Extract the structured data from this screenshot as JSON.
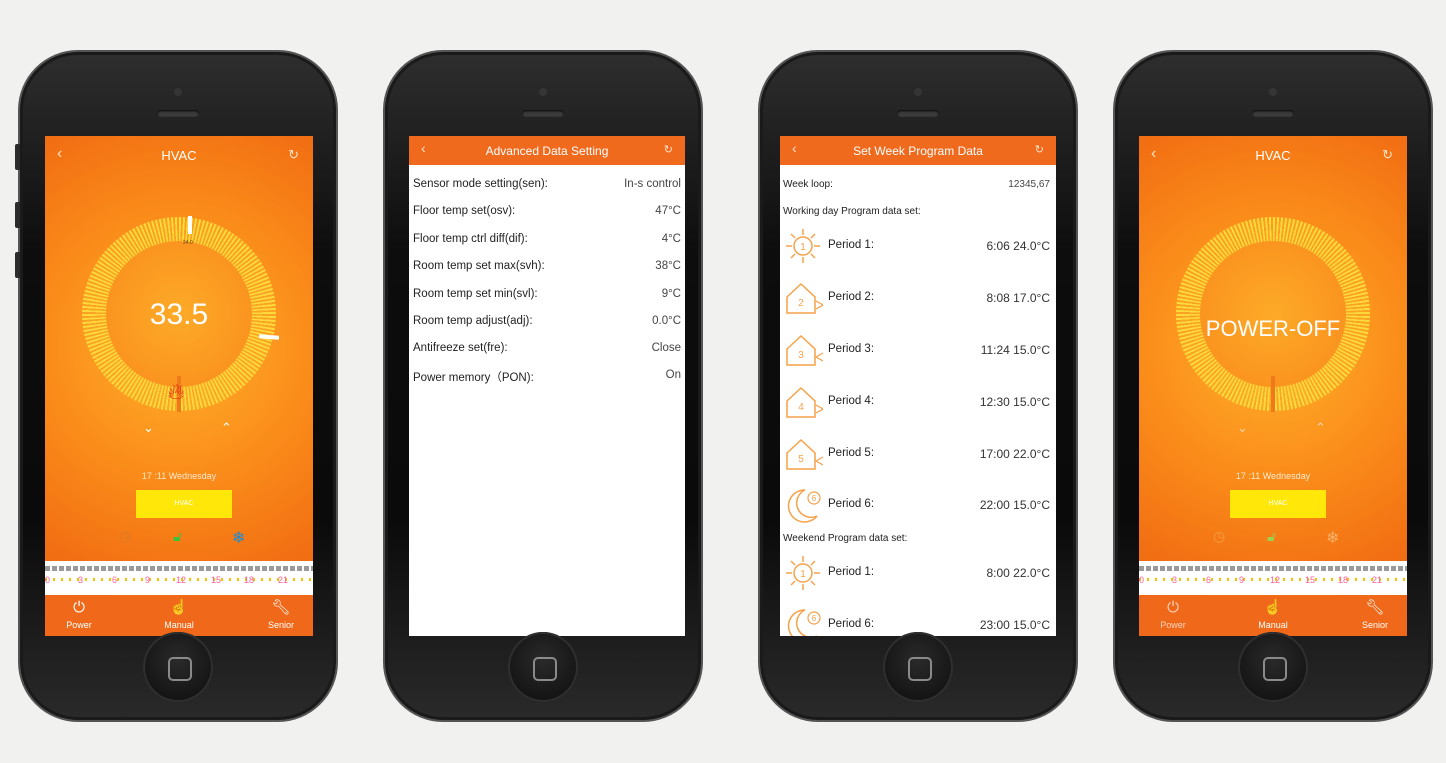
{
  "colors": {
    "accent": "#f06a1e",
    "mode_button": "#ffe70a",
    "flame": "#e31b0f",
    "page_bg": "#f1f1ef"
  },
  "phone1": {
    "title": "HVAC",
    "back_icon": "chevron-left-icon",
    "refresh_icon": "refresh-icon",
    "temperature": "33.5",
    "set_point": "24.0",
    "time": "17 :11 Wednesday",
    "mode_button": "HVAC",
    "timeline_ticks": [
      "0",
      "3",
      "6",
      "9",
      "12",
      "15",
      "18",
      "21"
    ],
    "nav": [
      {
        "label": "Power",
        "icon": "power-icon"
      },
      {
        "label": "Manual",
        "icon": "hand-icon"
      },
      {
        "label": "Senior",
        "icon": "wrench-icon"
      }
    ]
  },
  "phone2": {
    "title": "Advanced Data Setting",
    "rows": [
      {
        "label": "Sensor mode setting(sen):",
        "value": "In-s control"
      },
      {
        "label": "Floor temp set(osv):",
        "value": "47°C"
      },
      {
        "label": "Floor temp ctrl diff(dif):",
        "value": "4°C"
      },
      {
        "label": "Room temp set max(svh):",
        "value": "38°C"
      },
      {
        "label": "Room temp set min(svl):",
        "value": "9°C"
      },
      {
        "label": "Room temp adjust(adj):",
        "value": "0.0°C"
      },
      {
        "label": "Antifreeze set(fre):",
        "value": "Close"
      },
      {
        "label": "Power memory（PON):",
        "value": "On"
      }
    ]
  },
  "phone3": {
    "title": "Set Week Program Data",
    "week_loop_label": "Week loop:",
    "week_loop_value": "12345,67",
    "working_heading": "Working day Program data set:",
    "working_periods": [
      {
        "label": "Period 1:",
        "value": "6:06 24.0°C",
        "icon": "sun-icon",
        "num": "1"
      },
      {
        "label": "Period 2:",
        "value": "8:08 17.0°C",
        "icon": "house-icon",
        "num": "2"
      },
      {
        "label": "Period 3:",
        "value": "11:24 15.0°C",
        "icon": "house-icon",
        "num": "3"
      },
      {
        "label": "Period 4:",
        "value": "12:30 15.0°C",
        "icon": "house-icon",
        "num": "4"
      },
      {
        "label": "Period 5:",
        "value": "17:00 22.0°C",
        "icon": "house-icon",
        "num": "5"
      },
      {
        "label": "Period 6:",
        "value": "22:00 15.0°C",
        "icon": "moon-icon",
        "num": "6"
      }
    ],
    "weekend_heading": "Weekend Program data set:",
    "weekend_periods": [
      {
        "label": "Period 1:",
        "value": "8:00 22.0°C",
        "icon": "sun-icon",
        "num": "1"
      },
      {
        "label": "Period 6:",
        "value": "23:00 15.0°C",
        "icon": "moon-icon",
        "num": "6"
      }
    ]
  },
  "phone4": {
    "title": "HVAC",
    "status": "POWER-OFF",
    "time": "17 :11 Wednesday",
    "mode_button": "HVAC",
    "timeline_ticks": [
      "0",
      "3",
      "6",
      "9",
      "12",
      "15",
      "18",
      "21"
    ],
    "nav": [
      {
        "label": "Power",
        "icon": "power-icon"
      },
      {
        "label": "Manual",
        "icon": "hand-icon"
      },
      {
        "label": "Senior",
        "icon": "wrench-icon"
      }
    ]
  }
}
